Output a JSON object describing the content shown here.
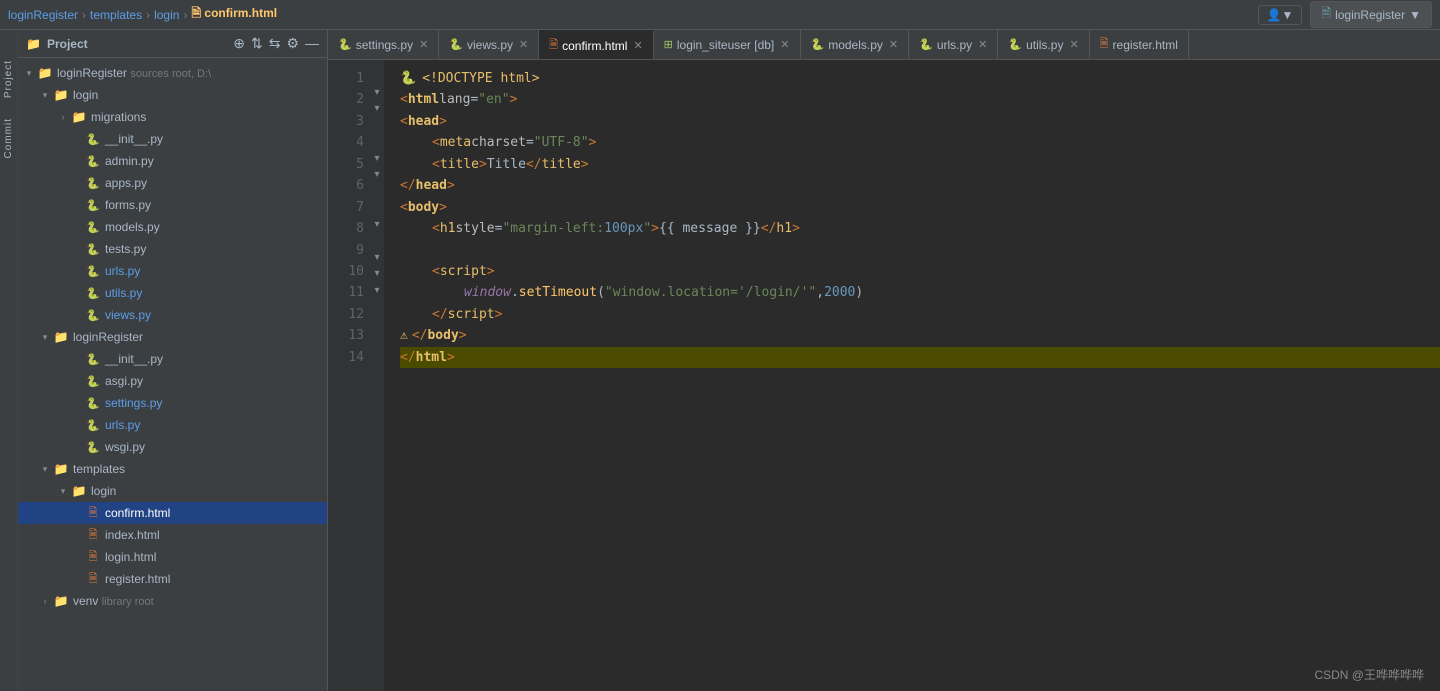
{
  "topbar": {
    "breadcrumb": [
      "loginRegister",
      "templates",
      "login",
      "confirm.html"
    ],
    "user_icon": "👤",
    "user_label": "",
    "project_label": "loginRegister",
    "project_icon": "▼"
  },
  "tabs": [
    {
      "id": "settings",
      "label": "settings.py",
      "type": "py",
      "active": false,
      "closable": true
    },
    {
      "id": "views",
      "label": "views.py",
      "type": "py",
      "active": false,
      "closable": true
    },
    {
      "id": "confirm",
      "label": "confirm.html",
      "type": "html",
      "active": true,
      "closable": true
    },
    {
      "id": "login_siteuser",
      "label": "login_siteuser [db]",
      "type": "db",
      "active": false,
      "closable": true
    },
    {
      "id": "models",
      "label": "models.py",
      "type": "py",
      "active": false,
      "closable": true
    },
    {
      "id": "urls",
      "label": "urls.py",
      "type": "py",
      "active": false,
      "closable": true
    },
    {
      "id": "utils",
      "label": "utils.py",
      "type": "py",
      "active": false,
      "closable": true
    },
    {
      "id": "register",
      "label": "register.html",
      "type": "html",
      "active": false,
      "closable": false
    }
  ],
  "file_tree": {
    "header": "Project",
    "root": {
      "label": "loginRegister",
      "sublabel": "sources root, D:\\",
      "expanded": true,
      "children": [
        {
          "label": "login",
          "type": "folder",
          "expanded": true,
          "children": [
            {
              "label": "migrations",
              "type": "folder",
              "expanded": false
            },
            {
              "label": "__init__.py",
              "type": "py"
            },
            {
              "label": "admin.py",
              "type": "py"
            },
            {
              "label": "apps.py",
              "type": "py"
            },
            {
              "label": "forms.py",
              "type": "py"
            },
            {
              "label": "models.py",
              "type": "py"
            },
            {
              "label": "tests.py",
              "type": "py"
            },
            {
              "label": "urls.py",
              "type": "py",
              "color": "blue"
            },
            {
              "label": "utils.py",
              "type": "py",
              "color": "blue"
            },
            {
              "label": "views.py",
              "type": "py",
              "color": "blue"
            }
          ]
        },
        {
          "label": "loginRegister",
          "type": "folder",
          "expanded": true,
          "children": [
            {
              "label": "__init__.py",
              "type": "py"
            },
            {
              "label": "asgi.py",
              "type": "py"
            },
            {
              "label": "settings.py",
              "type": "py",
              "color": "blue"
            },
            {
              "label": "urls.py",
              "type": "py",
              "color": "blue"
            },
            {
              "label": "wsgi.py",
              "type": "py"
            }
          ]
        },
        {
          "label": "templates",
          "type": "folder",
          "expanded": true,
          "children": [
            {
              "label": "login",
              "type": "folder",
              "expanded": true,
              "children": [
                {
                  "label": "confirm.html",
                  "type": "html",
                  "selected": true
                },
                {
                  "label": "index.html",
                  "type": "html"
                },
                {
                  "label": "login.html",
                  "type": "html"
                },
                {
                  "label": "register.html",
                  "type": "html"
                }
              ]
            }
          ]
        },
        {
          "label": "venv",
          "type": "folder",
          "sublabel": "library root",
          "expanded": false
        }
      ]
    }
  },
  "editor": {
    "lines": [
      {
        "no": 1,
        "fold": "",
        "content": [
          {
            "type": "doctype",
            "text": "<!DOCTYPE html>"
          }
        ]
      },
      {
        "no": 2,
        "fold": "▾",
        "content": [
          {
            "type": "tag",
            "text": "<html"
          },
          {
            "type": "attr",
            "text": " lang"
          },
          {
            "type": "plain",
            "text": "="
          },
          {
            "type": "attr-val",
            "text": "\"en\""
          },
          {
            "type": "tag",
            "text": ">"
          }
        ]
      },
      {
        "no": 3,
        "fold": "▾",
        "content": [
          {
            "type": "tag",
            "text": "<head>"
          }
        ]
      },
      {
        "no": 4,
        "fold": "",
        "content": [
          {
            "type": "tag",
            "text": "<meta"
          },
          {
            "type": "attr",
            "text": " charset"
          },
          {
            "type": "plain",
            "text": "="
          },
          {
            "type": "attr-val",
            "text": "\"UTF-8\""
          },
          {
            "type": "tag",
            "text": ">"
          }
        ],
        "indent": 2
      },
      {
        "no": 5,
        "fold": "",
        "content": [
          {
            "type": "tag",
            "text": "<title>"
          },
          {
            "type": "text-content",
            "text": "Title"
          },
          {
            "type": "tag",
            "text": "</title>"
          }
        ],
        "indent": 2
      },
      {
        "no": 6,
        "fold": "▾",
        "content": [
          {
            "type": "tag",
            "text": "</head>"
          }
        ]
      },
      {
        "no": 7,
        "fold": "▾",
        "content": [
          {
            "type": "tag",
            "text": "<body>"
          }
        ]
      },
      {
        "no": 8,
        "fold": "",
        "content": [
          {
            "type": "tag",
            "text": "<h1"
          },
          {
            "type": "attr",
            "text": " style"
          },
          {
            "type": "plain",
            "text": "="
          },
          {
            "type": "attr-val",
            "text": "\"margin-left: "
          },
          {
            "type": "js-num",
            "text": "100px"
          },
          {
            "type": "attr-val",
            "text": "\""
          },
          {
            "type": "tag",
            "text": ">"
          },
          {
            "type": "template-var",
            "text": "{{ message }}"
          },
          {
            "type": "tag",
            "text": "</h1>"
          }
        ],
        "indent": 2
      },
      {
        "no": 9,
        "fold": "",
        "content": []
      },
      {
        "no": 10,
        "fold": "▾",
        "content": [
          {
            "type": "tag",
            "text": "<script>"
          }
        ],
        "indent": 2
      },
      {
        "no": 11,
        "fold": "",
        "content": [
          {
            "type": "js-fn",
            "text": "window"
          },
          {
            "type": "plain",
            "text": "."
          },
          {
            "type": "js-fn",
            "text": "setTimeout"
          },
          {
            "type": "plain",
            "text": "("
          },
          {
            "type": "js-str",
            "text": "\"window.location='/login/'\""
          },
          {
            "type": "plain",
            "text": ","
          },
          {
            "type": "js-num",
            "text": "2000"
          },
          {
            "type": "plain",
            "text": ")"
          }
        ],
        "indent": 3
      },
      {
        "no": 12,
        "fold": "▾",
        "content": [
          {
            "type": "tag",
            "text": "</"
          },
          {
            "type": "tag",
            "text": "script>"
          }
        ],
        "indent": 2
      },
      {
        "no": 13,
        "fold": "▾",
        "content": [
          {
            "type": "tag",
            "text": "</body>"
          }
        ]
      },
      {
        "no": 14,
        "fold": "▾",
        "content": [
          {
            "type": "tag",
            "text": "</html>"
          }
        ]
      }
    ]
  },
  "sidebar_icons": [
    "Project",
    "Commit"
  ],
  "watermark": "CSDN @王哗哗哗哗"
}
